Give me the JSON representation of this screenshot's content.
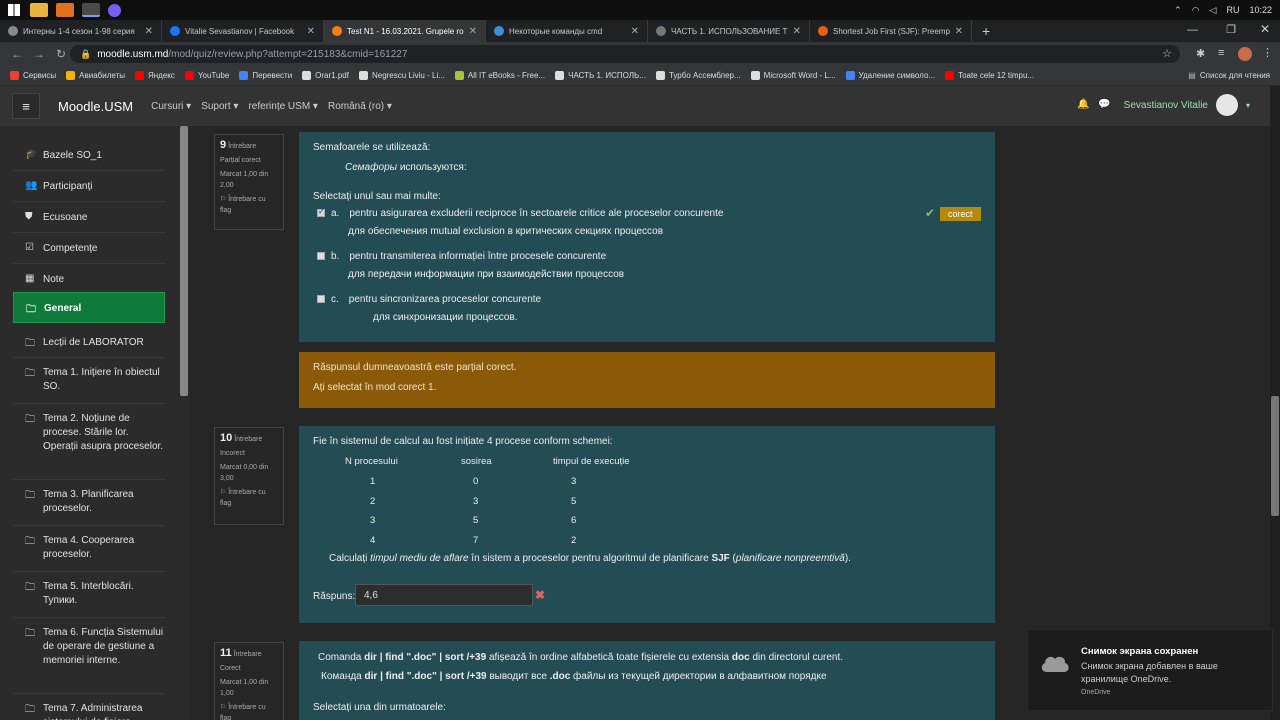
{
  "os": {
    "time": "10:22",
    "lang": "RU"
  },
  "tabs": [
    {
      "label": "Интерны 1-4 сезон 1-98 серия",
      "color": "#8a8a8a",
      "active": false
    },
    {
      "label": "Vitalie Sevastianov | Facebook",
      "color": "#1877f2",
      "active": false
    },
    {
      "label": "Test N1 - 16.03.2021. Grupele ro",
      "color": "#f98012",
      "active": true
    },
    {
      "label": "Некоторые команды cmd",
      "color": "#3b8fd6",
      "active": false
    },
    {
      "label": "ЧАСТЬ 1. ИСПОЛЬЗОВАНИЕ ТУ",
      "color": "#777",
      "active": false
    },
    {
      "label": "Shortest Job First (SJF): Preempti",
      "color": "#e8620e",
      "active": false
    }
  ],
  "address": {
    "host": "moodle.usm.md",
    "path": "/mod/quiz/review.php?attempt=215183&cmid=161227"
  },
  "bookmarks": [
    {
      "label": "Сервисы",
      "color": "#e94235"
    },
    {
      "label": "Авиабилеты",
      "color": "#f4b400"
    },
    {
      "label": "Яндекс",
      "color": "#ff0000"
    },
    {
      "label": "YouTube",
      "color": "#ff0000"
    },
    {
      "label": "Перевести",
      "color": "#4285f4"
    },
    {
      "label": "Orar1.pdf",
      "color": "#dddddd"
    },
    {
      "label": "Negrescu Liviu - Li...",
      "color": "#dddddd"
    },
    {
      "label": "All IT eBooks - Free...",
      "color": "#a4c639"
    },
    {
      "label": "ЧАСТЬ 1. ИСПОЛЬ...",
      "color": "#dddddd"
    },
    {
      "label": "Турбо Ассемблер...",
      "color": "#dddddd"
    },
    {
      "label": "Microsoft Word - L...",
      "color": "#dddddd"
    },
    {
      "label": "Удаление символо...",
      "color": "#4285f4"
    },
    {
      "label": "Toate cele 12 timpu...",
      "color": "#ff0000"
    }
  ],
  "bookmarks_other": "Список для чтения",
  "moodle": {
    "brand": "Moodle.USM",
    "menu": [
      "Cursuri",
      "Suport",
      "referințe USM",
      "Română (ro)"
    ],
    "user": "Sevastianov Vitalie"
  },
  "sidebar": [
    {
      "label": "Bazele SO_1",
      "icon": "graduation-cap-icon",
      "glyph": "🎓"
    },
    {
      "label": "Participanți",
      "icon": "users-icon",
      "glyph": "👥"
    },
    {
      "label": "Ecusoane",
      "icon": "shield-icon",
      "glyph": "⛊"
    },
    {
      "label": "Competențe",
      "icon": "checkbox-icon",
      "glyph": "☑"
    },
    {
      "label": "Note",
      "icon": "grid-icon",
      "glyph": "▦"
    },
    {
      "label": "General",
      "icon": "folder-icon",
      "glyph": "🗀"
    },
    {
      "label": "Lecții de LABORATOR",
      "icon": "folder-icon",
      "glyph": "🗀"
    },
    {
      "label": "Tema 1. Inițiere în obiectul SO.",
      "icon": "folder-icon",
      "glyph": "🗀"
    },
    {
      "label": "Tema 2. Noțiune de procese. Stările lor. Operații asupra proceselor.",
      "icon": "folder-icon",
      "glyph": "🗀"
    },
    {
      "label": "Tema 3. Planificarea proceselor.",
      "icon": "folder-icon",
      "glyph": "🗀"
    },
    {
      "label": "Tema 4. Cooperarea proceselor.",
      "icon": "folder-icon",
      "glyph": "🗀"
    },
    {
      "label": "Tema 5. Interblocări. Тупики.",
      "icon": "folder-icon",
      "glyph": "🗀"
    },
    {
      "label": "Tema 6. Funcția Sistemului de operare de gestiune a memoriei interne.",
      "icon": "folder-icon",
      "glyph": "🗀"
    },
    {
      "label": "Tema 7. Administrarea sistemului de fișiere",
      "icon": "folder-icon",
      "glyph": "🗀"
    }
  ],
  "q9": {
    "num": "9",
    "word": "Întrebare",
    "state": "Parțial corect",
    "mark": "Marcat 1,00 din 2,00",
    "flag": "Întrebare cu flag",
    "text_ro": "Semafoarele se utilizează:",
    "text_ru_em": "Семафоры",
    "text_ru_rest": " используются:",
    "prompt": "Selectați unul sau mai multe:",
    "options": [
      {
        "letter": "a.",
        "ro": "pentru asigurarea excluderii reciproce în sectoarele critice ale proceselor concurente",
        "ru": "для обеспечения mutual exclusion  в критических секциях процессов",
        "checked": true
      },
      {
        "letter": "b.",
        "ro": "pentru transmiterea informației între procesele concurente",
        "ru": "для передачи информации при взаимодействии процессов",
        "checked": false
      },
      {
        "letter": "c.",
        "ro": "pentru sincronizarea proceselor concurente",
        "ru": "для синхронизации процессов.",
        "checked": false
      }
    ],
    "badge": "corect",
    "feedback1": "Răspunsul dumneavoastră este parțial corect.",
    "feedback2": "Ați selectat în mod corect 1."
  },
  "q10": {
    "num": "10",
    "word": "Întrebare",
    "state": "Incorect",
    "mark": "Marcat 0,00 din 3,00",
    "flag": "Întrebare cu flag",
    "text": "Fie în sistemul de calcul au fost inițiate  4 procese conform schemei:",
    "headers": [
      "N procesului",
      "sosirea",
      "timpul de execuție"
    ],
    "rows": [
      [
        "1",
        "0",
        "3"
      ],
      [
        "2",
        "3",
        "5"
      ],
      [
        "3",
        "5",
        "6"
      ],
      [
        "4",
        "7",
        "2"
      ]
    ],
    "calc_pre": "Calculați ",
    "calc_em": "timpul mediu de aflare",
    "calc_mid": " în sistem a proceselor pentru algoritmul de planificare ",
    "calc_strong": "SJF",
    "calc_open": " (",
    "calc_em2": "planificare nonpreemtivă",
    "calc_close": ").",
    "answer_label": "Răspuns:",
    "answer_value": "4,6"
  },
  "q11": {
    "num": "11",
    "word": "Întrebare",
    "state": "Corect",
    "mark": "Marcat 1,00 din 1,00",
    "flag": "Întrebare cu flag",
    "l1_pre": "Comanda ",
    "l1_cmd": "dir | find  \".doc\" | sort /+39",
    "l1_mid": " afișează în ordine alfabetică toate fișierele cu extensia ",
    "l1_doc": "doc",
    "l1_end": " din directorul curent.",
    "l2_pre": "Команда ",
    "l2_cmd": "dir | find  \".doc\" | sort /+39",
    "l2_mid": " выводит все ",
    "l2_doc": ".doc",
    "l2_end": "  файлы из текущей  директории в алфавитном порядке",
    "prompt": "Selectați una din urmatoarele:"
  },
  "toast": {
    "title": "Снимок экрана сохранен",
    "body": "Снимок экрана добавлен в ваше хранилище OneDrive.",
    "source": "OneDrive"
  }
}
